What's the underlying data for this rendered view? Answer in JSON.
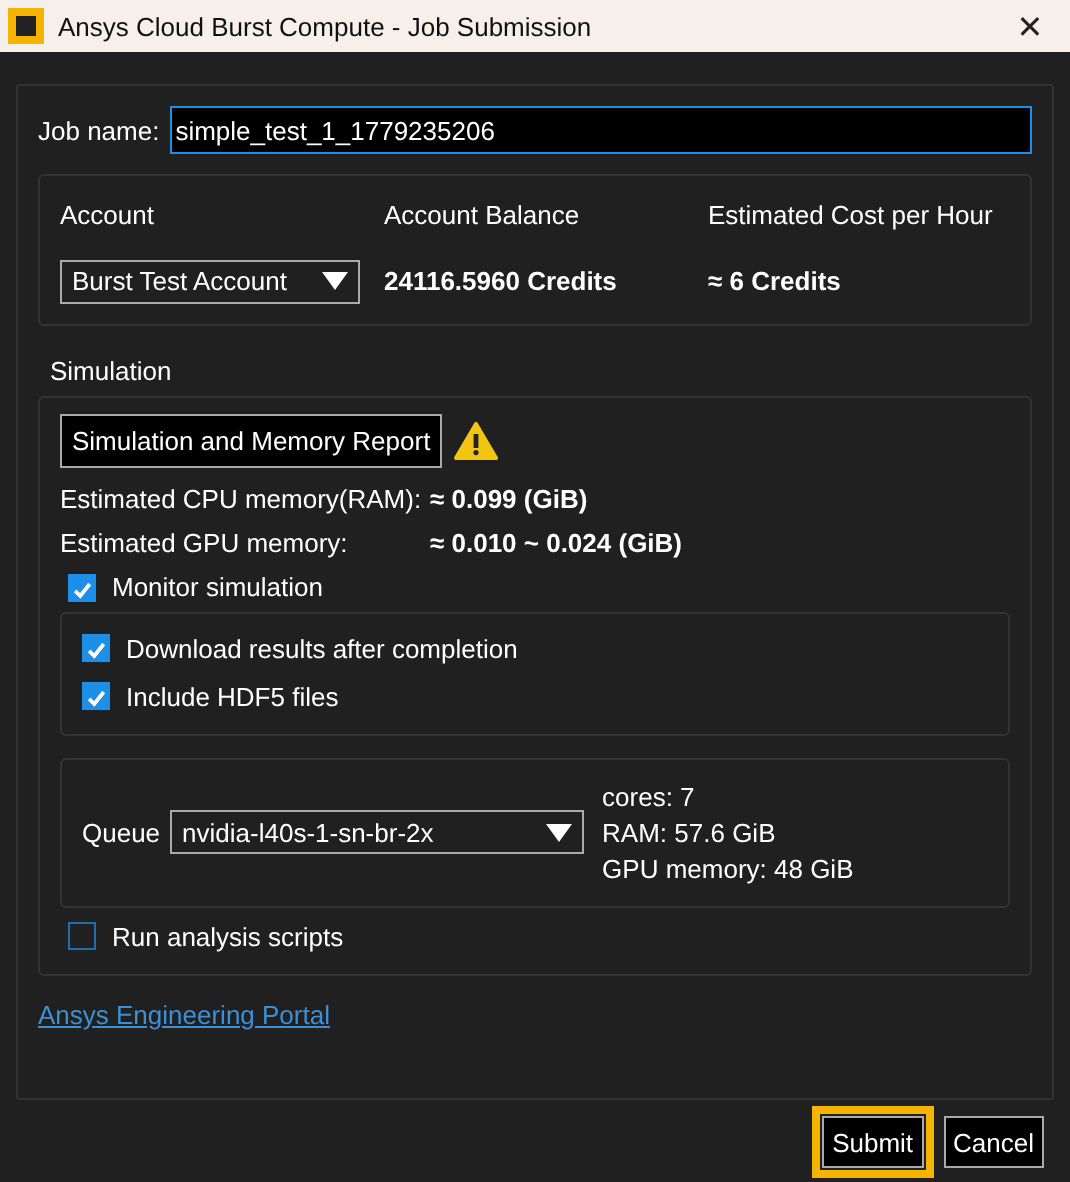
{
  "window": {
    "title": "Ansys Cloud Burst Compute - Job Submission",
    "close": "✕"
  },
  "job_name": {
    "label": "Job name:",
    "value": "simple_test_1_1779235206"
  },
  "account": {
    "columns": [
      "Account",
      "Account Balance",
      "Estimated Cost per Hour"
    ],
    "selected_account": "Burst Test Account",
    "balance": "24116.5960 Credits",
    "cost": "≈ 6 Credits"
  },
  "simulation": {
    "label": "Simulation",
    "report_button": "Simulation and Memory Report",
    "warning": true,
    "memory": [
      {
        "label": "Estimated CPU memory(RAM):",
        "value": "≈ 0.099 (GiB)"
      },
      {
        "label": "Estimated GPU memory:",
        "value": "≈ 0.010 ~ 0.024 (GiB)"
      }
    ],
    "monitor": {
      "label": "Monitor simulation",
      "checked": true
    },
    "monitor_options": [
      {
        "label": "Download results after completion",
        "checked": true
      },
      {
        "label": "Include HDF5 files",
        "checked": true
      }
    ],
    "queue": {
      "label": "Queue",
      "value": "nvidia-l40s-1-sn-br-2x",
      "specs": [
        "cores: 7",
        "RAM: 57.6 GiB",
        "GPU memory: 48 GiB"
      ]
    },
    "run_scripts": {
      "label": "Run analysis scripts",
      "checked": false
    }
  },
  "link": "Ansys Engineering Portal",
  "buttons": [
    {
      "label": "Submit",
      "highlighted": true
    },
    {
      "label": "Cancel",
      "highlighted": false
    }
  ]
}
